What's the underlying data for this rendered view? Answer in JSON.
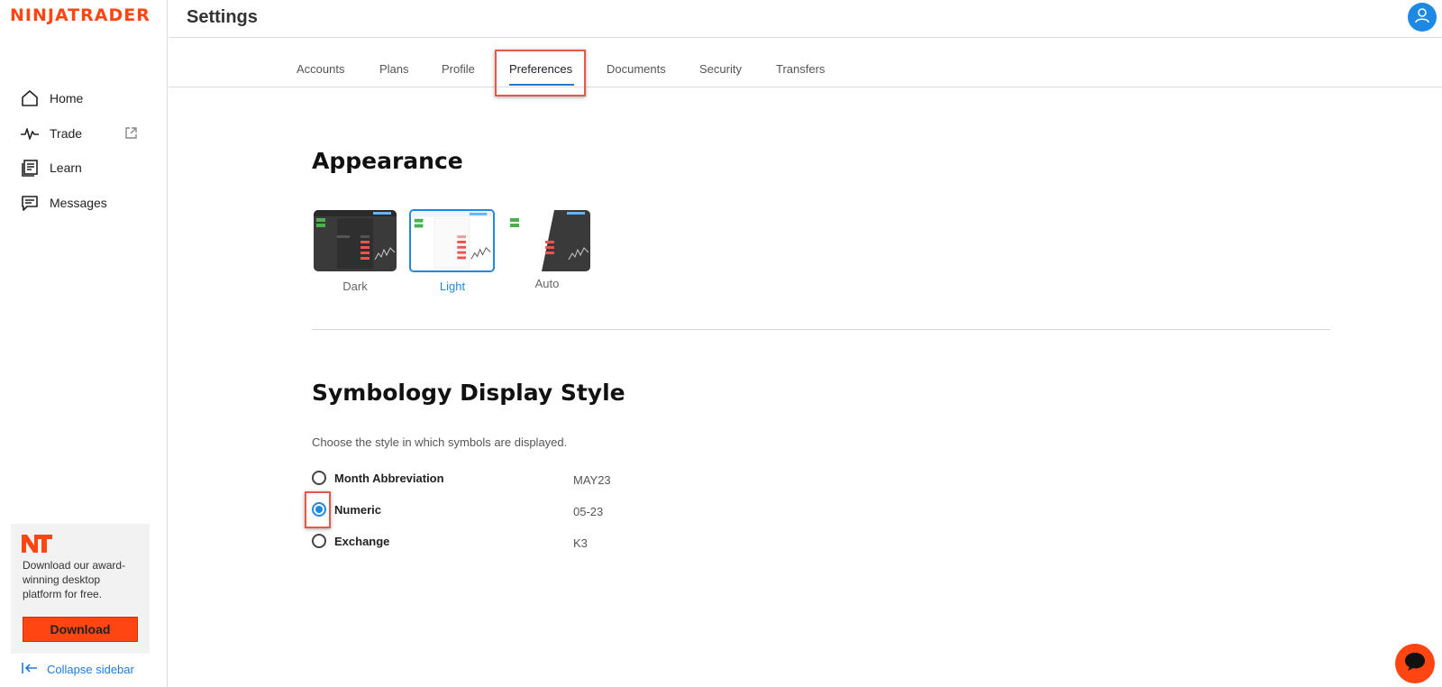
{
  "sidebar": {
    "logo": "NINJATRADER",
    "items": [
      {
        "label": "Home",
        "icon": "home-icon"
      },
      {
        "label": "Trade",
        "icon": "pulse-icon"
      },
      {
        "label": "Learn",
        "icon": "book-icon"
      },
      {
        "label": "Messages",
        "icon": "message-icon"
      }
    ],
    "promo": {
      "text": "Download our award-winning desktop platform for free.",
      "button_label": "Download"
    },
    "collapse_label": "Collapse sidebar"
  },
  "header": {
    "title": "Settings"
  },
  "tabs": [
    {
      "label": "Accounts"
    },
    {
      "label": "Plans"
    },
    {
      "label": "Profile"
    },
    {
      "label": "Preferences",
      "active": true
    },
    {
      "label": "Documents"
    },
    {
      "label": "Security"
    },
    {
      "label": "Transfers"
    }
  ],
  "appearance": {
    "title": "Appearance",
    "themes": [
      {
        "label": "Dark"
      },
      {
        "label": "Light",
        "selected": true
      },
      {
        "label": "Auto"
      }
    ]
  },
  "symbology": {
    "title": "Symbology Display Style",
    "subtitle": "Choose the style in which symbols are displayed.",
    "options": [
      {
        "label": "Month Abbreviation",
        "example": "MAY23",
        "checked": false
      },
      {
        "label": "Numeric",
        "example": "05-23",
        "checked": true
      },
      {
        "label": "Exchange",
        "example": "K3",
        "checked": false
      }
    ]
  },
  "colors": {
    "brand": "#ff4612",
    "accent": "#1e88e5",
    "highlight": "#e25a4a"
  }
}
